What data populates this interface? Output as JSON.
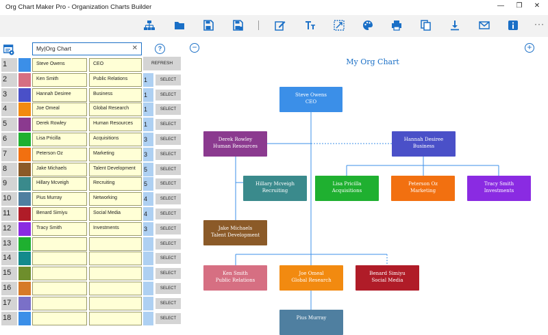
{
  "window": {
    "title": "Org Chart Maker Pro - Organization Charts Builder",
    "controls": [
      "—",
      "❐",
      "✕"
    ]
  },
  "toolbar": {
    "icons": [
      "org-chart-icon",
      "open-folder-icon",
      "save-icon",
      "save-as-icon",
      "edit-icon",
      "font-icon",
      "resize-icon",
      "palette-icon",
      "print-icon",
      "copy-icon",
      "download-icon",
      "email-icon",
      "info-icon"
    ],
    "more_label": "···"
  },
  "left": {
    "search_value": "My|Org Chart",
    "help_label": "?",
    "refresh_label": "REFRESH",
    "select_label": "SELECT",
    "rows": [
      {
        "num": "1",
        "color": "#3b8fe8",
        "name": "Steve Owens",
        "title": "CEO",
        "level": ""
      },
      {
        "num": "2",
        "color": "#d66f82",
        "name": "Ken Smith",
        "title": "Public Relations",
        "level": "1"
      },
      {
        "num": "3",
        "color": "#4a50c8",
        "name": "Hannah Desiree",
        "title": "Business",
        "level": "1"
      },
      {
        "num": "4",
        "color": "#f28a10",
        "name": "Joe Omeal",
        "title": "Global Research",
        "level": "1"
      },
      {
        "num": "5",
        "color": "#8b3a8f",
        "name": "Derek Rowley",
        "title": "Human Resources",
        "level": "1"
      },
      {
        "num": "6",
        "color": "#1fb030",
        "name": "Lisa Pricilla",
        "title": "Acquisitions",
        "level": "3"
      },
      {
        "num": "7",
        "color": "#f27010",
        "name": "Peterson Oz",
        "title": "Marketing",
        "level": "3"
      },
      {
        "num": "8",
        "color": "#8b5a28",
        "name": "Jake Michaels",
        "title": "Talent Development",
        "level": "5"
      },
      {
        "num": "9",
        "color": "#3a8a8c",
        "name": "Hillary Mcveigh",
        "title": "Recruiting",
        "level": "5"
      },
      {
        "num": "10",
        "color": "#4f7fa0",
        "name": "Pius Murray",
        "title": "Networking",
        "level": "4"
      },
      {
        "num": "11",
        "color": "#b01c28",
        "name": "Benard Simiyu",
        "title": "Social Media",
        "level": "4"
      },
      {
        "num": "12",
        "color": "#8a2be2",
        "name": "Tracy Smith",
        "title": "Investments",
        "level": "3"
      },
      {
        "num": "13",
        "color": "#1fb030",
        "name": "",
        "title": "",
        "level": ""
      },
      {
        "num": "14",
        "color": "#138a8c",
        "name": "",
        "title": "",
        "level": ""
      },
      {
        "num": "15",
        "color": "#6e8e2c",
        "name": "",
        "title": "",
        "level": ""
      },
      {
        "num": "16",
        "color": "#d67a28",
        "name": "",
        "title": "",
        "level": ""
      },
      {
        "num": "17",
        "color": "#7a70c8",
        "name": "",
        "title": "",
        "level": ""
      },
      {
        "num": "18",
        "color": "#3b8fe8",
        "name": "",
        "title": "",
        "level": ""
      }
    ]
  },
  "chart": {
    "title": "My Org Chart",
    "zoom_out_label": "−",
    "zoom_in_label": "+",
    "nodes": [
      {
        "id": "ceo",
        "name": "Steve Owens",
        "role": "CEO",
        "color": "#3b8fe8"
      },
      {
        "id": "hr",
        "name": "Derek Rowley",
        "role": "Human Resources",
        "color": "#8b3a8f"
      },
      {
        "id": "biz",
        "name": "Hannah Desiree",
        "role": "Business",
        "color": "#4a50c8"
      },
      {
        "id": "rec",
        "name": "Hillary Mcveigh",
        "role": "Recruiting",
        "color": "#3a8a8c"
      },
      {
        "id": "acq",
        "name": "Lisa Pricilla",
        "role": "Acquisitions",
        "color": "#1fb030"
      },
      {
        "id": "mkt",
        "name": "Peterson Oz",
        "role": "Marketing",
        "color": "#f27010"
      },
      {
        "id": "inv",
        "name": "Tracy Smith",
        "role": "Investments",
        "color": "#8a2be2"
      },
      {
        "id": "tal",
        "name": "Jake Michaels",
        "role": "Talent Development",
        "color": "#8b5a28"
      },
      {
        "id": "pr",
        "name": "Ken Smith",
        "role": "Public Relations",
        "color": "#d66f82"
      },
      {
        "id": "gr",
        "name": "Joe Omeal",
        "role": "Global Research",
        "color": "#f28a10"
      },
      {
        "id": "sm",
        "name": "Benard Simiyu",
        "role": "Social Media",
        "color": "#b01c28"
      },
      {
        "id": "net",
        "name": "Pius Murray",
        "role": "",
        "color": "#4f7fa0"
      }
    ]
  }
}
